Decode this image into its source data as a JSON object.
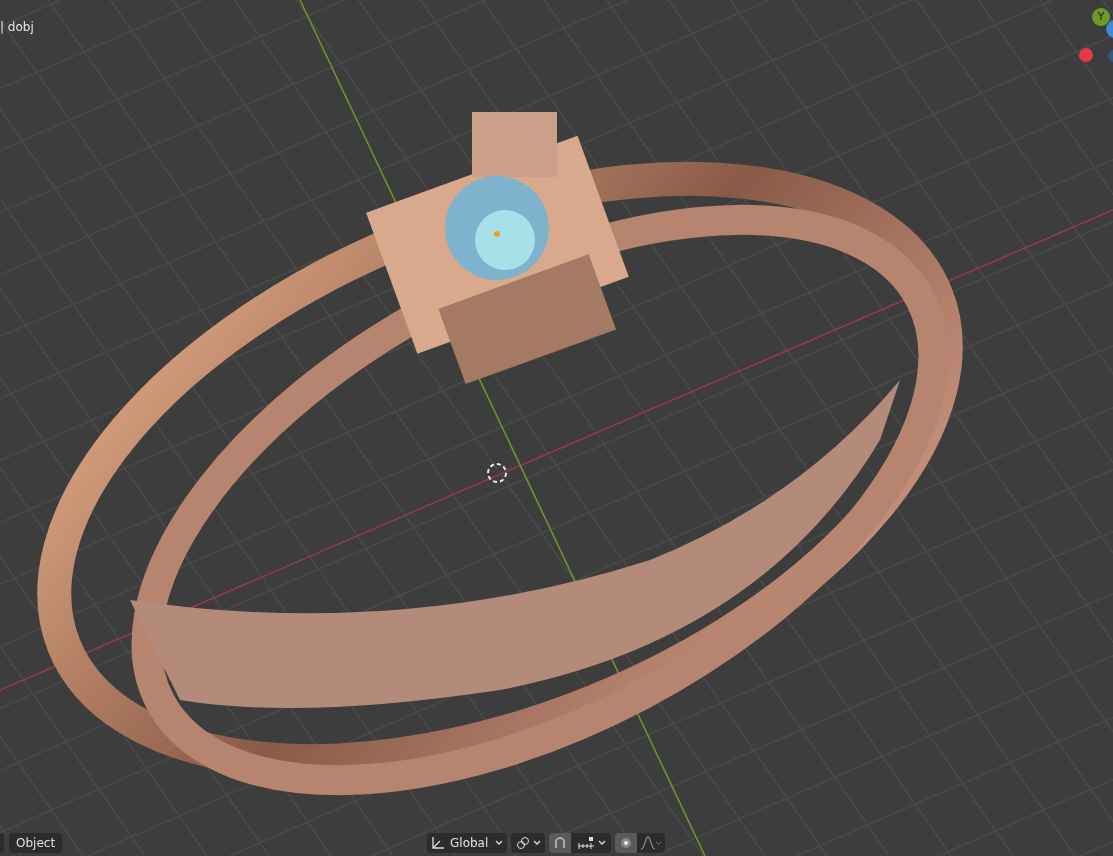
{
  "viewport": {
    "object_label": "| dobj",
    "gizmo": {
      "y_label": "Y"
    }
  },
  "toolbar": {
    "mode_button": "Object",
    "orientation": "Global",
    "snap": {
      "on": true
    },
    "proportional_editing": {
      "on": true
    }
  }
}
